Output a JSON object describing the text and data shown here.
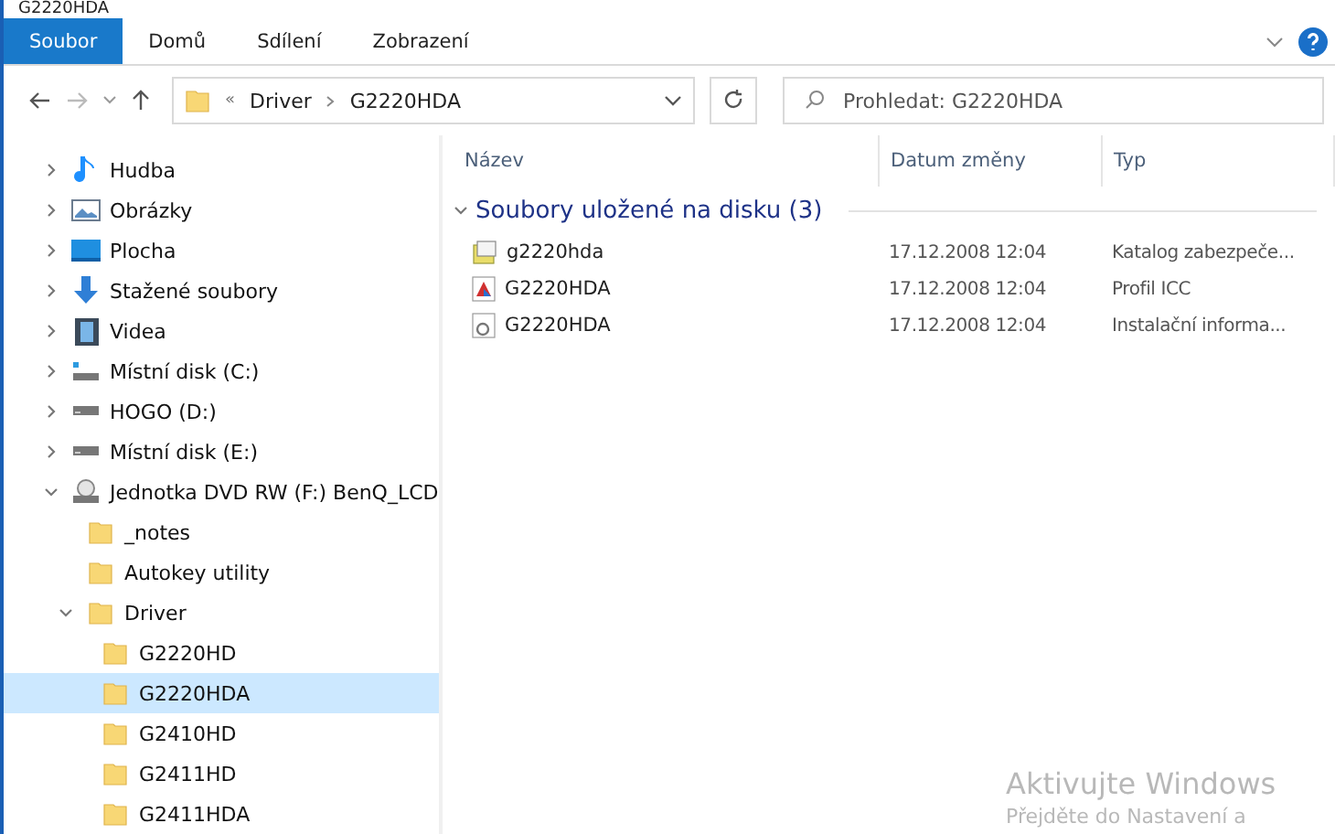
{
  "window": {
    "title": "G2220HDA"
  },
  "ribbon": {
    "tabs": [
      {
        "label": "Soubor",
        "selected": true
      },
      {
        "label": "Domů",
        "selected": false
      },
      {
        "label": "Sdílení",
        "selected": false
      },
      {
        "label": "Zobrazení",
        "selected": false
      }
    ]
  },
  "address": {
    "path": [
      {
        "label": "«"
      },
      {
        "label": "Driver"
      },
      {
        "label": "G2220HDA"
      }
    ]
  },
  "search": {
    "placeholder": "Prohledat: G2220HDA"
  },
  "sidebar": {
    "items": [
      {
        "label": "Hudba",
        "kind": "music",
        "expanded": false,
        "selected": false
      },
      {
        "label": "Obrázky",
        "kind": "pictures",
        "expanded": false,
        "selected": false
      },
      {
        "label": "Plocha",
        "kind": "desktop",
        "expanded": false,
        "selected": false
      },
      {
        "label": "Stažené soubory",
        "kind": "downloads",
        "expanded": false,
        "selected": false
      },
      {
        "label": "Videa",
        "kind": "videos",
        "expanded": false,
        "selected": false
      },
      {
        "label": "Místní disk (C:)",
        "kind": "system-disk",
        "expanded": false,
        "selected": false
      },
      {
        "label": "HOGO (D:)",
        "kind": "disk",
        "expanded": false,
        "selected": false
      },
      {
        "label": "Místní disk (E:)",
        "kind": "disk",
        "expanded": false,
        "selected": false
      },
      {
        "label": "Jednotka DVD RW (F:) BenQ_LCD",
        "kind": "dvd",
        "expanded": true,
        "selected": false,
        "children": [
          {
            "label": "_notes",
            "kind": "folder",
            "selected": false
          },
          {
            "label": "Autokey utility",
            "kind": "folder",
            "selected": false
          },
          {
            "label": "Driver",
            "kind": "folder",
            "expanded": true,
            "selected": false,
            "children": [
              {
                "label": "G2220HD",
                "kind": "folder",
                "selected": false
              },
              {
                "label": "G2220HDA",
                "kind": "folder",
                "selected": true
              },
              {
                "label": "G2410HD",
                "kind": "folder",
                "selected": false
              },
              {
                "label": "G2411HD",
                "kind": "folder",
                "selected": false
              },
              {
                "label": "G2411HDA",
                "kind": "folder",
                "selected": false
              }
            ]
          }
        ]
      }
    ]
  },
  "table": {
    "columns": [
      "Název",
      "Datum změny",
      "Typ"
    ],
    "group": {
      "label": "Soubory uložené na disku (3)",
      "expanded": true
    },
    "rows": [
      {
        "name": "g2220hda",
        "kind": "catalog",
        "date": "17.12.2008 12:04",
        "type": "Katalog zabezpeče..."
      },
      {
        "name": "G2220HDA",
        "kind": "icc",
        "date": "17.12.2008 12:04",
        "type": "Profil ICC"
      },
      {
        "name": "G2220HDA",
        "kind": "inf",
        "date": "17.12.2008 12:04",
        "type": "Instalační informa..."
      }
    ]
  },
  "activation": {
    "title": "Aktivujte Windows",
    "text": "Přejděte do Nastavení a"
  }
}
